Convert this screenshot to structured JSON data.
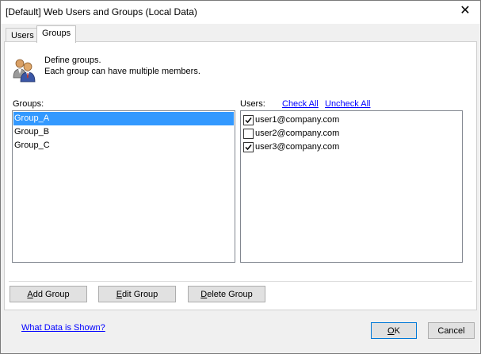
{
  "window": {
    "title": "[Default] Web Users and Groups (Local Data)"
  },
  "tabs": [
    {
      "label": "Users"
    },
    {
      "label": "Groups",
      "active": true
    }
  ],
  "description": {
    "line1": "Define groups.",
    "line2": "Each group can have multiple members."
  },
  "groups_panel": {
    "label": "Groups:",
    "items": [
      {
        "label": "Group_A",
        "selected": true
      },
      {
        "label": "Group_B",
        "selected": false
      },
      {
        "label": "Group_C",
        "selected": false
      }
    ]
  },
  "users_panel": {
    "label": "Users:",
    "check_all": "Check All",
    "uncheck_all": "Uncheck All",
    "items": [
      {
        "label": "user1@company.com",
        "checked": true
      },
      {
        "label": "user2@company.com",
        "checked": false
      },
      {
        "label": "user3@company.com",
        "checked": true
      }
    ]
  },
  "buttons": {
    "add_group": {
      "label_first": "A",
      "label_rest": "dd Group"
    },
    "edit_group": {
      "label_first": "E",
      "label_rest": "dit Group"
    },
    "delete_group": {
      "label_first": "D",
      "label_rest": "elete Group"
    },
    "ok": {
      "label_first": "O",
      "label_rest": "K"
    },
    "cancel": {
      "label": "Cancel"
    }
  },
  "footer": {
    "what_data_link": "What Data is Shown?"
  },
  "colors": {
    "selection": "#3399ff",
    "link": "#0000ff",
    "default_button_border": "#0078d7"
  },
  "icons": {
    "close": "close-icon",
    "people": "people-icon",
    "checkmark": "checkmark-icon"
  }
}
